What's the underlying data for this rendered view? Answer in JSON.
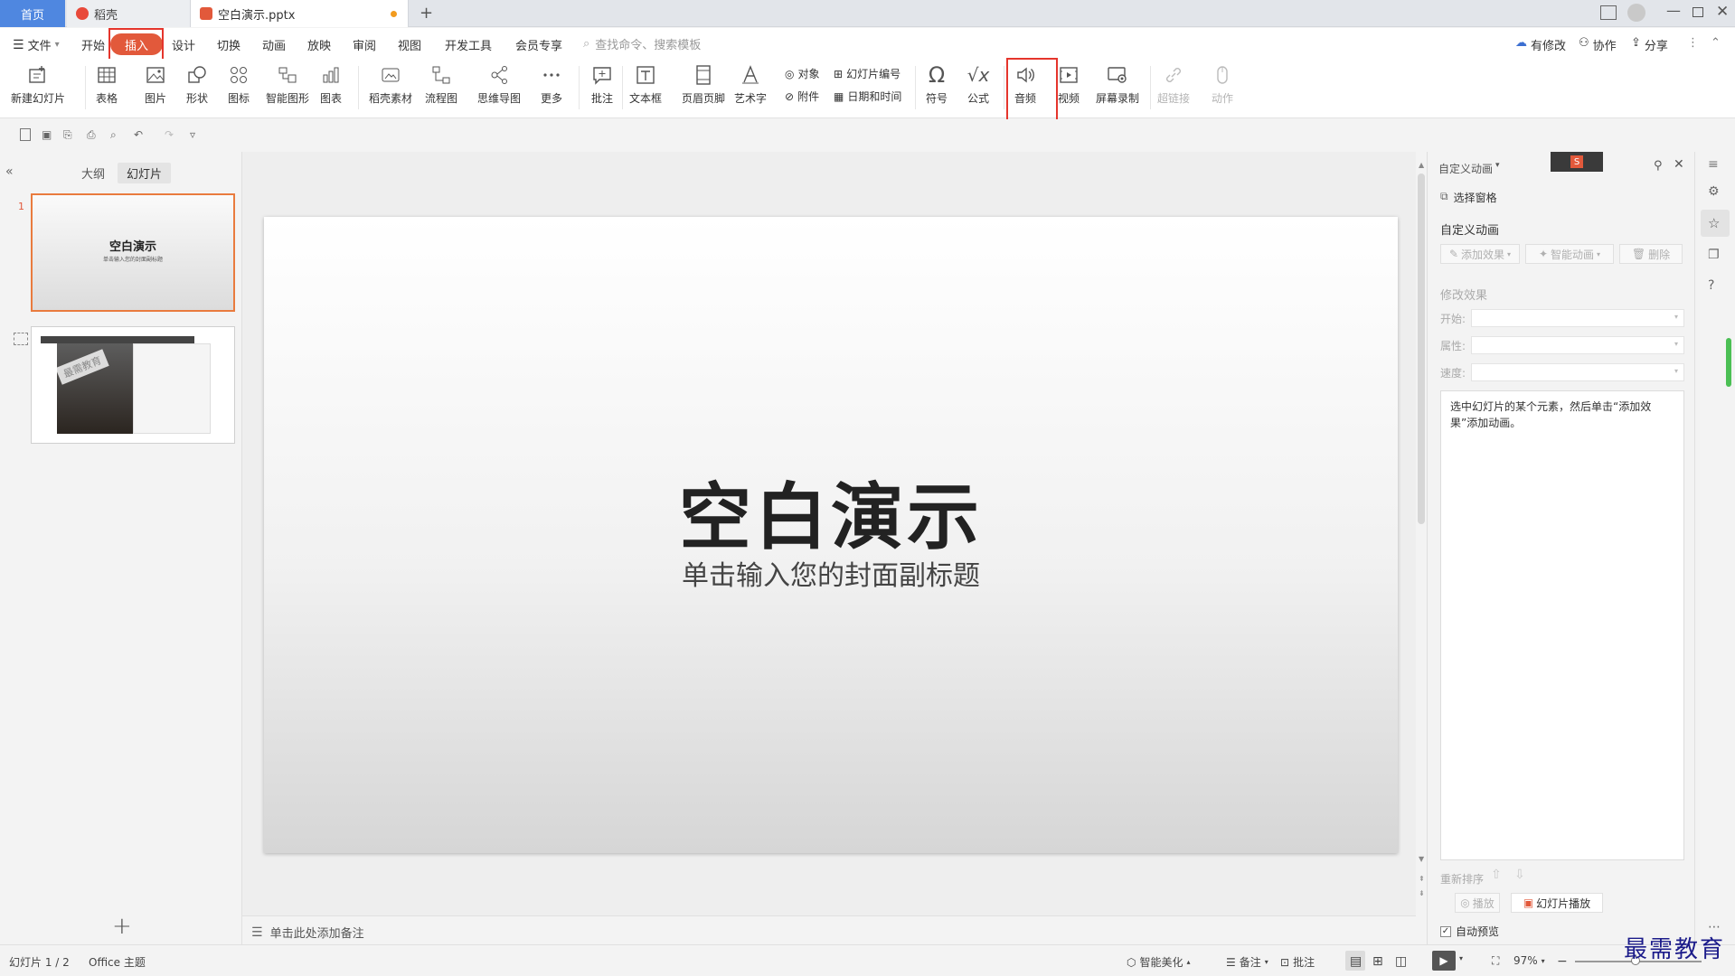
{
  "tabs": {
    "home": "首页",
    "daoke": "稻壳",
    "doc": "空白演示.pptx"
  },
  "menu": {
    "file": "文件",
    "start": "开始",
    "insert": "插入",
    "design": "设计",
    "transition": "切换",
    "animation": "动画",
    "slideshow": "放映",
    "review": "审阅",
    "view": "视图",
    "devtools": "开发工具",
    "member": "会员专享",
    "search_placeholder": "查找命令、搜索模板",
    "modified": "有修改",
    "collab": "协作",
    "share": "分享"
  },
  "ribbon": {
    "new_slide": "新建幻灯片",
    "table": "表格",
    "picture": "图片",
    "shape": "形状",
    "icon": "图标",
    "smartart": "智能图形",
    "chart": "图表",
    "daoke_material": "稻壳素材",
    "flowchart": "流程图",
    "mindmap": "思维导图",
    "more": "更多",
    "comment": "批注",
    "textbox": "文本框",
    "header_footer": "页眉页脚",
    "wordart": "艺术字",
    "object": "对象",
    "attachment": "附件",
    "slide_number": "幻灯片编号",
    "datetime": "日期和时间",
    "symbol": "符号",
    "formula": "公式",
    "audio": "音频",
    "video": "视频",
    "screen_record": "屏幕录制",
    "hyperlink": "超链接",
    "action": "动作"
  },
  "left_panel": {
    "outline_tab": "大纲",
    "slides_tab": "幻灯片",
    "slide1_num": "1",
    "thumb1_title": "空白演示",
    "thumb1_sub": "单击输入您的封面副标题",
    "thumb2_wm": "最需教育"
  },
  "slide": {
    "title": "空白演示",
    "subtitle": "单击输入您的封面副标题"
  },
  "notes": {
    "placeholder": "单击此处添加备注"
  },
  "right_panel": {
    "header": "自定义动画",
    "select_pane": "选择窗格",
    "section_title": "自定义动画",
    "add_effect": "添加效果",
    "smart_anim": "智能动画",
    "delete": "删除",
    "modify_effect": "修改效果",
    "start_label": "开始:",
    "property_label": "属性:",
    "speed_label": "速度:",
    "hint": "选中幻灯片的某个元素，然后单击“添加效果”添加动画。",
    "reorder": "重新排序",
    "play": "播放",
    "slideshow": "幻灯片播放",
    "autopreview": "自动预览"
  },
  "status": {
    "slide_pos": "幻灯片 1 / 2",
    "theme": "Office 主题",
    "beautify": "智能美化",
    "notes": "备注",
    "comments": "批注",
    "zoom": "97%"
  },
  "watermark": "最需教育",
  "colors": {
    "accent": "#e2593b",
    "home_tab": "#4f87e0",
    "highlight_box": "#e5352c",
    "selected_thumb": "#e97b3e"
  }
}
